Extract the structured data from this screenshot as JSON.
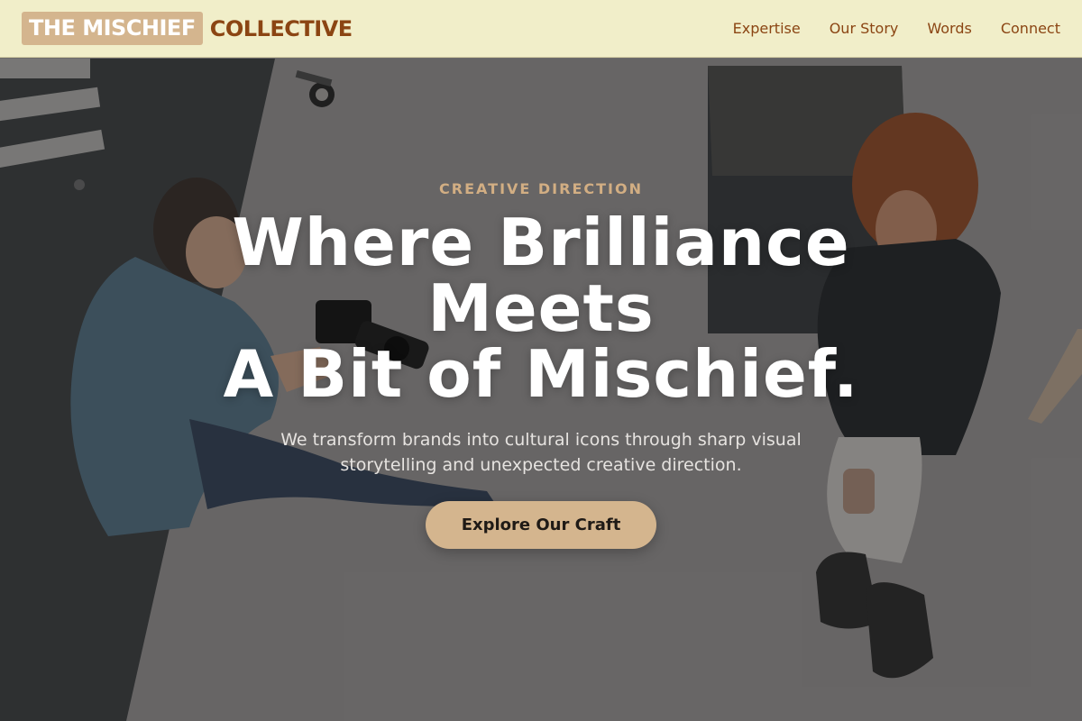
{
  "header": {
    "logo_box": "THE MISCHIEF",
    "logo_word": "COLLECTIVE",
    "nav": [
      "Expertise",
      "Our Story",
      "Words",
      "Connect"
    ]
  },
  "hero": {
    "eyebrow": "CREATIVE DIRECTION",
    "headline_line1": "Where Brilliance",
    "headline_line2": "Meets",
    "headline_line3": "A Bit of Mischief.",
    "subline_line1": "We transform brands into cultural icons through sharp visual",
    "subline_line2": "storytelling and unexpected creative direction.",
    "cta_label": "Explore Our Craft"
  },
  "colors": {
    "header_bg": "#f1eec9",
    "brand_brown": "#8b4513",
    "accent_tan": "#d4b58e",
    "eyebrow_tan": "#d2ae83"
  }
}
